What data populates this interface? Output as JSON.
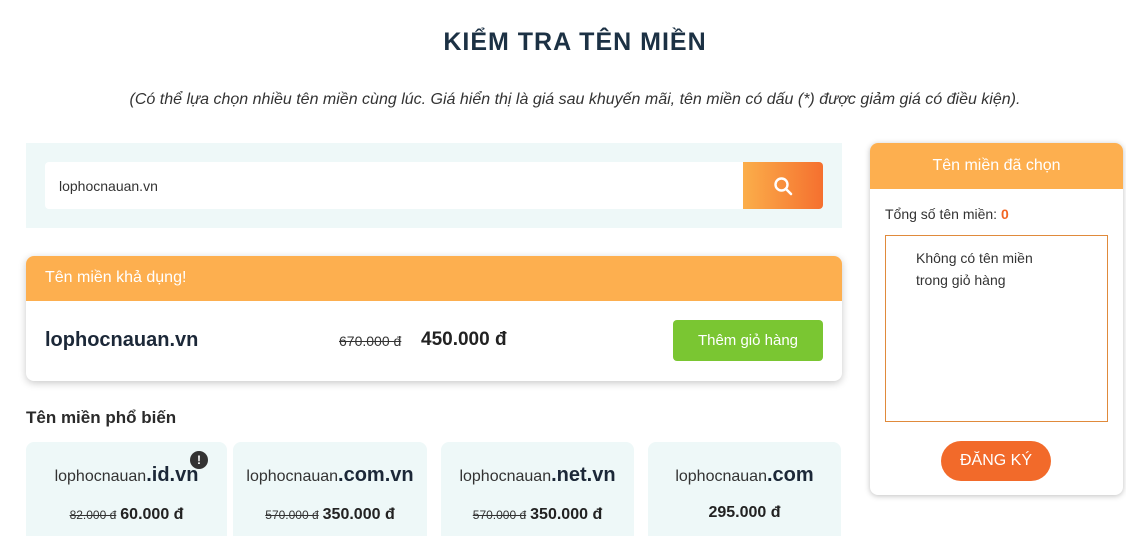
{
  "page": {
    "title": "KIỂM TRA TÊN MIỀN",
    "subtitle": "(Có thể lựa chọn nhiều tên miền cùng lúc. Giá hiển thị là giá sau khuyến mãi, tên miền có dấu (*) được giảm giá có điều kiện)."
  },
  "search": {
    "value": "lophocnauan.vn",
    "icon": "search-icon"
  },
  "available": {
    "header": "Tên miền khả dụng!",
    "domain": "lophocnauan.vn",
    "old_price": "670.000 đ",
    "new_price": "450.000 đ",
    "add_button": "Thêm giỏ hàng"
  },
  "popular": {
    "title": "Tên miền phổ biến",
    "items": [
      {
        "base": "lophocnauan",
        "ext": ".id.vn",
        "old_price": "82.000 đ",
        "new_price": "60.000 đ",
        "badge": "!"
      },
      {
        "base": "lophocnauan",
        "ext": ".com.vn",
        "old_price": "570.000 đ",
        "new_price": "350.000 đ"
      },
      {
        "base": "lophocnauan",
        "ext": ".net.vn",
        "old_price": "570.000 đ",
        "new_price": "350.000 đ"
      },
      {
        "base": "lophocnauan",
        "ext": ".com",
        "old_price": "",
        "new_price": "295.000 đ"
      }
    ]
  },
  "cart": {
    "header": "Tên miền đã chọn",
    "total_label": "Tổng số tên miền:",
    "total_count": "0",
    "empty_text": "Không có tên miền trong giỏ hàng",
    "register_button": "ĐĂNG KÝ"
  },
  "colors": {
    "accent_orange": "#fdaf4f",
    "button_green": "#7ac632",
    "register_orange": "#f26a2a",
    "light_bg": "#eef8f8"
  }
}
